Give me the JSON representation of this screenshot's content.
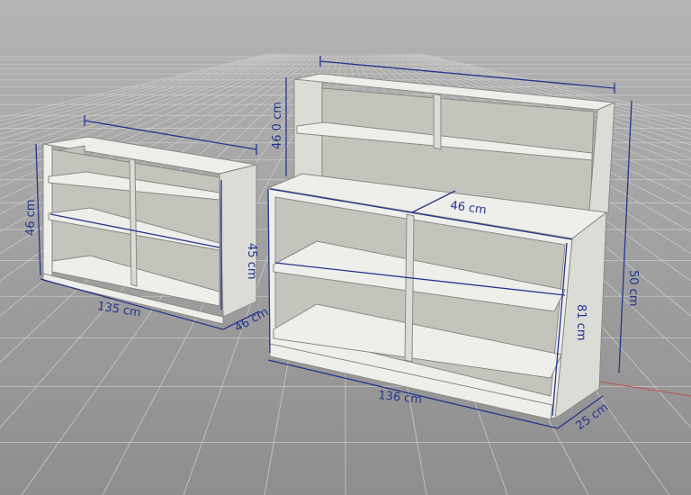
{
  "colors": {
    "background_top": "#b4b4b4",
    "background_bottom": "#8e8e8e",
    "grid_line": "#c9c9c9",
    "grid_axis_red": "#c0504d",
    "panel_light": "#eeeeea",
    "panel_mid": "#dcdcd6",
    "panel_dark": "#c4c4bd",
    "panel_outline": "#8a8a84",
    "dimension_ink": "#26358f"
  },
  "dimensions": {
    "small_shelf": {
      "width": "135 cm",
      "height": "46 cm",
      "depth": "46 cm",
      "inner_height": "45 cm"
    },
    "large_unit": {
      "width": "136 cm",
      "depth": "25 cm",
      "total_height": "50 cm",
      "base_height": "81 cm",
      "top_depth": "46 cm",
      "hutch_height": "46 0 cm"
    }
  }
}
